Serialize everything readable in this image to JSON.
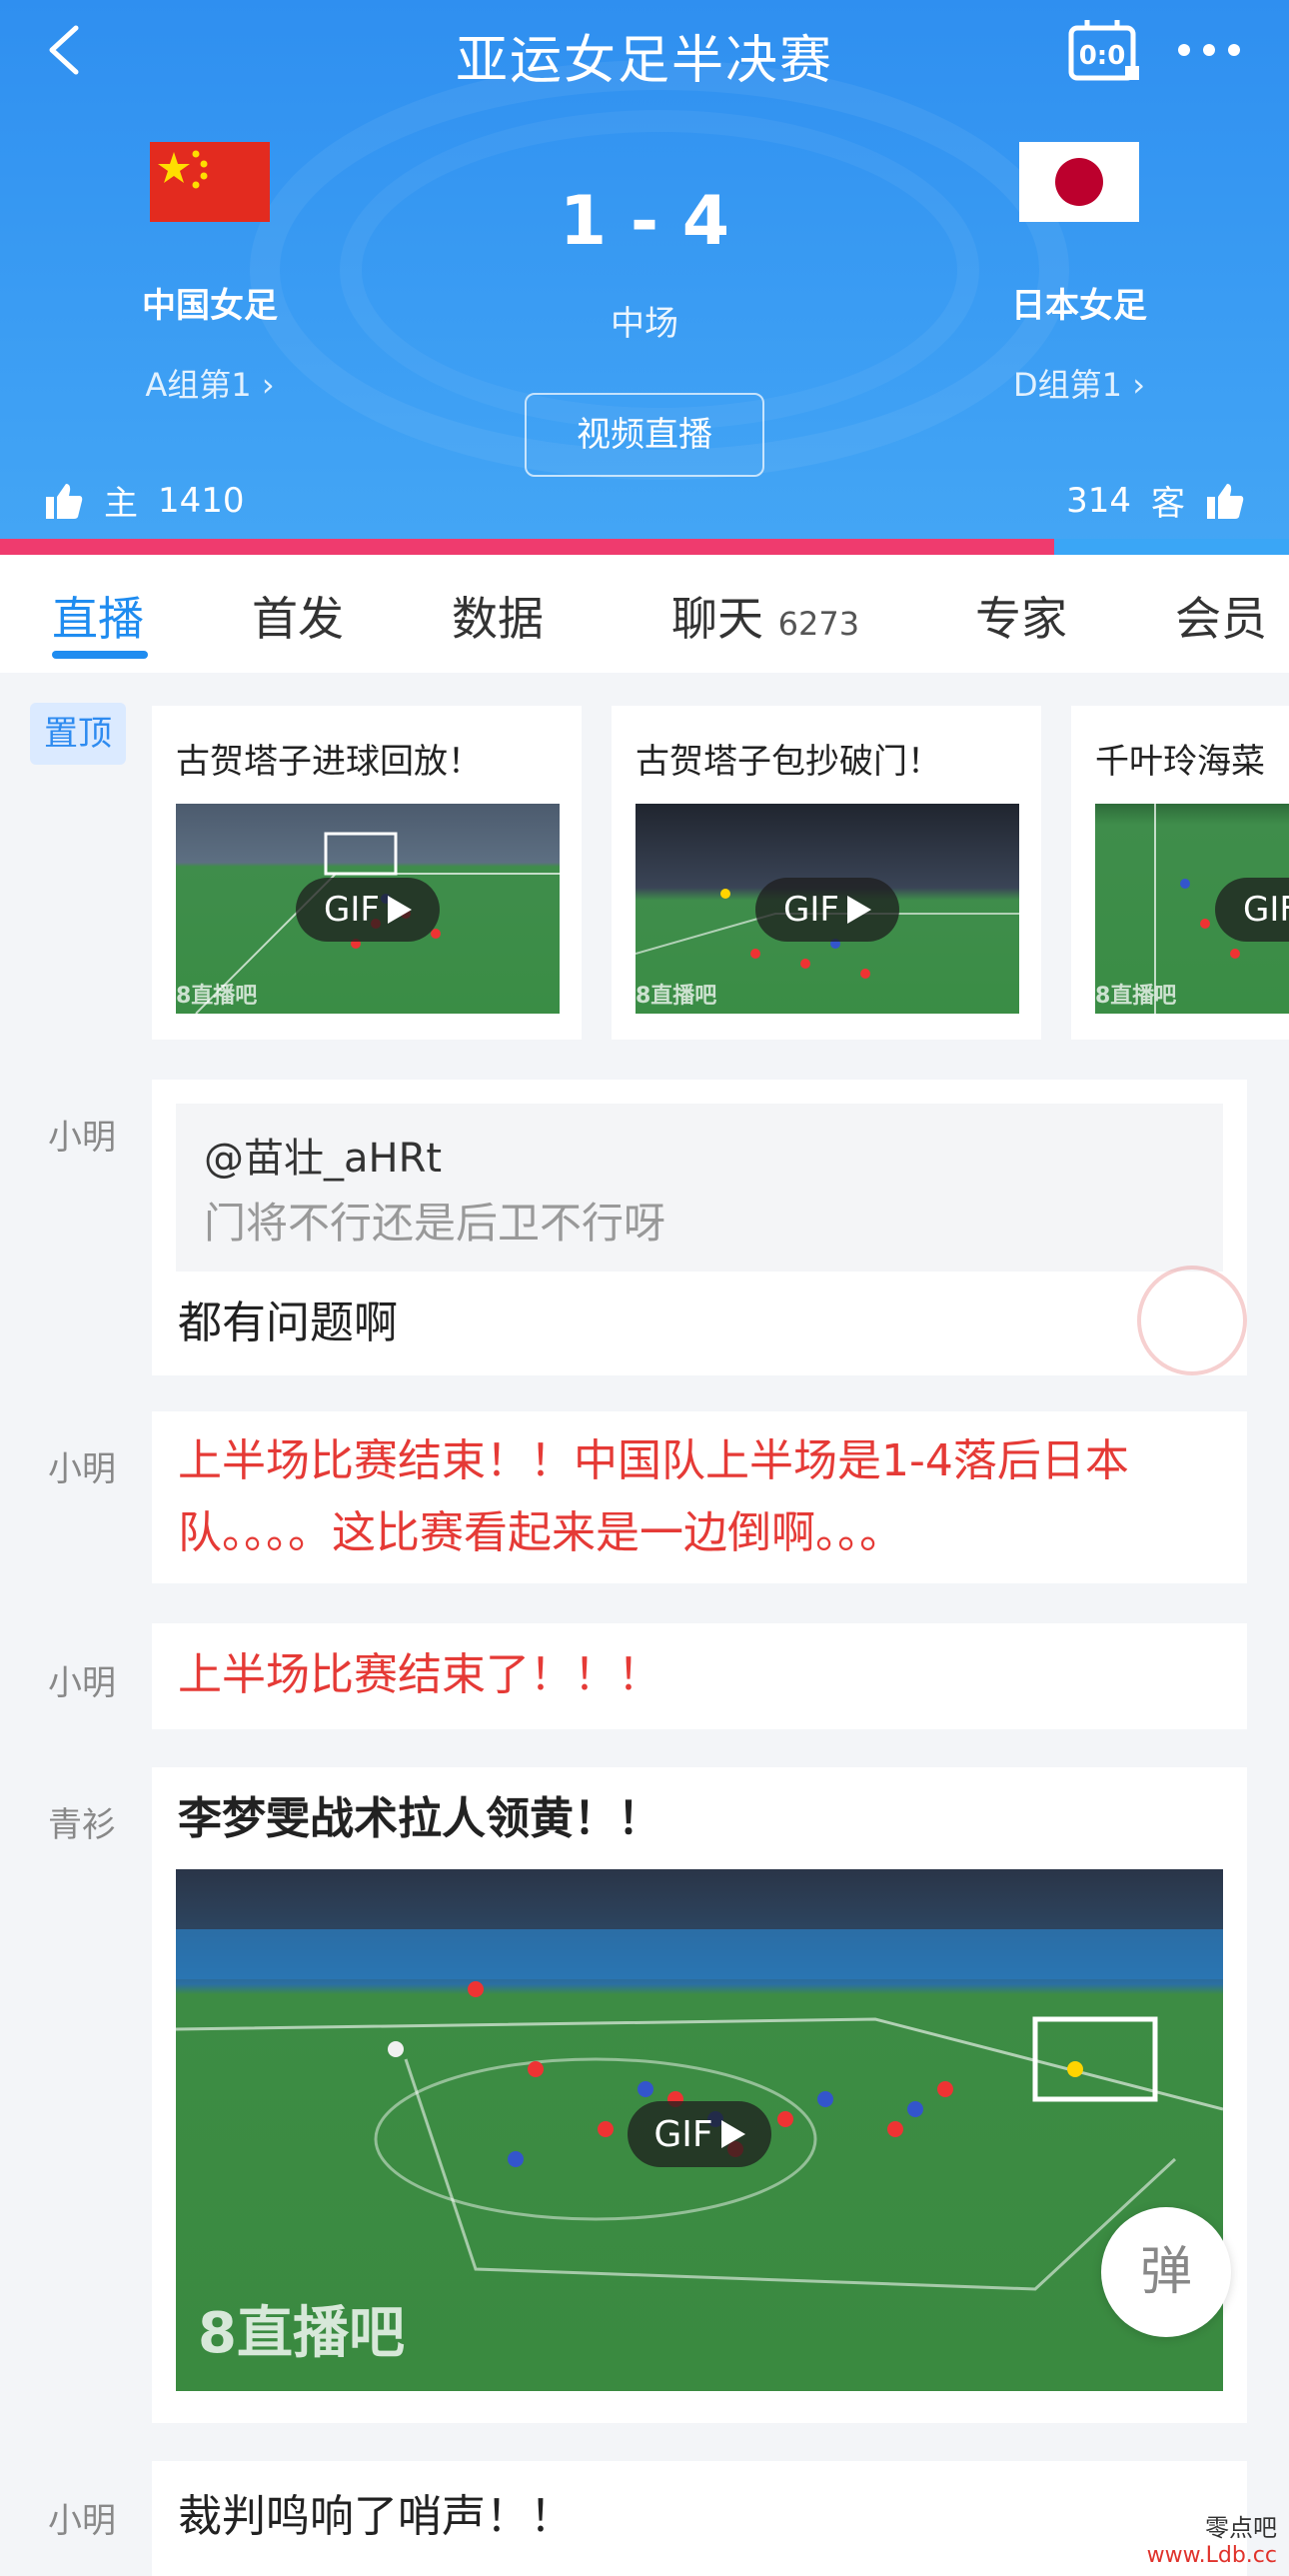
{
  "header": {
    "title": "亚运女足半决赛",
    "score_board_label": "0:0",
    "home": {
      "name": "中国女足",
      "group": "A组第1"
    },
    "away": {
      "name": "日本女足",
      "group": "D组第1"
    },
    "score": "1 - 4",
    "status": "中场",
    "live_button": "视频直播",
    "likes_home_label": "主",
    "likes_home": "1410",
    "likes_away": "314",
    "likes_away_label": "客",
    "home_share": 0.818,
    "colors": {
      "header": "#2f8ff0",
      "home_bar": "#ef3b6e",
      "away_bar": "#3aa6f6"
    }
  },
  "tabs": [
    {
      "label": "直播"
    },
    {
      "label": "首发"
    },
    {
      "label": "数据"
    },
    {
      "label": "聊天",
      "count": "6273"
    },
    {
      "label": "专家"
    },
    {
      "label": "会员"
    }
  ],
  "pinned": {
    "badge": "置顶",
    "items": [
      {
        "title": "古贺塔子进球回放！",
        "gif": "GIF",
        "watermark": "8直播吧"
      },
      {
        "title": "古贺塔子包抄破门！",
        "gif": "GIF",
        "watermark": "8直播吧"
      },
      {
        "title": "千叶玲海菜",
        "gif": "GIF",
        "watermark": "8直播吧"
      }
    ]
  },
  "feed": [
    {
      "author": "小明",
      "quote_user": "@苗壮_aHRt",
      "quote_text": "门将不行还是后卫不行呀",
      "text": "都有问题啊"
    },
    {
      "author": "小明",
      "text_line1": "上半场比赛结束！！中国队上半场是1-4落后日本",
      "text_line2": "队。。。。这比赛看起来是一边倒啊。。。"
    },
    {
      "author": "小明",
      "text": "上半场比赛结束了！！！"
    },
    {
      "author": "青衫",
      "text": "李梦雯战术拉人领黄！！",
      "gif": "GIF",
      "watermark": "8直播吧"
    },
    {
      "author": "小明",
      "text": "裁判鸣响了哨声！！"
    }
  ],
  "danmu_button": "弹",
  "site_watermark": {
    "line1": "零点吧",
    "line2": "www.Ldb.cc"
  }
}
